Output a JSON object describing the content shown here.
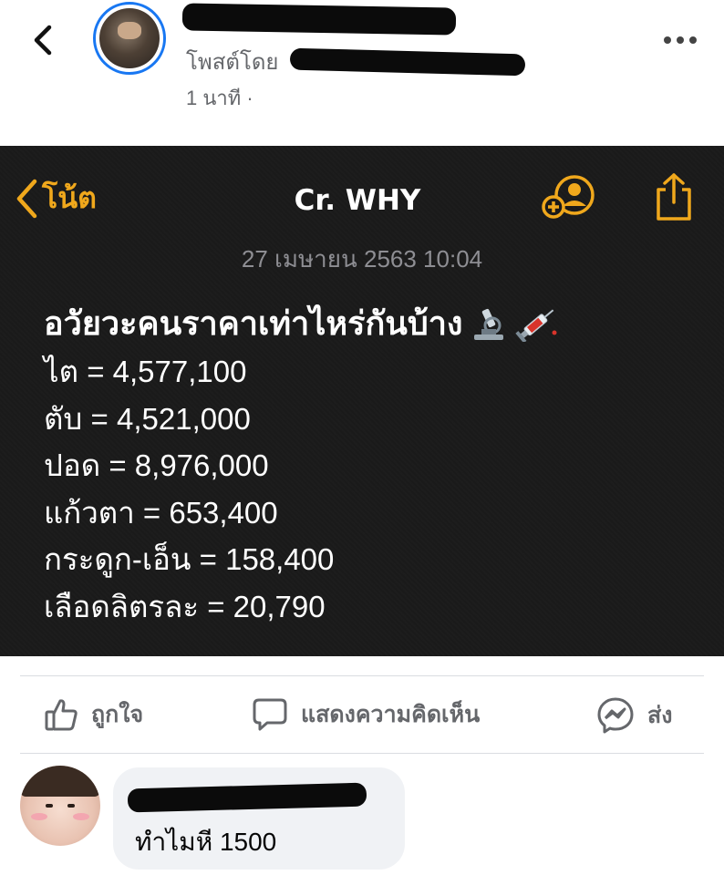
{
  "post": {
    "posted_by_label": "โพสต์โดย",
    "time": "1 นาที ·"
  },
  "note": {
    "back_label": "โน้ต",
    "title": "Cr. WHY",
    "date": "27 เมษายน 2563 10:04",
    "heading": "อวัยวะคนราคาเท่าไหร่กันบ้าง",
    "lines": [
      "ไต = 4,577,100",
      "ตับ = 4,521,000",
      "ปอด = 8,976,000",
      "แก้วตา = 653,400",
      "กระดูก-เอ็น = 158,400",
      "เลือดลิตรละ = 20,790"
    ],
    "accent_color": "#f0a81c",
    "background_color": "#1a1a1a"
  },
  "actions": {
    "like": "ถูกใจ",
    "comment": "แสดงความคิดเห็น",
    "share": "ส่ง"
  },
  "comment": {
    "text": "ทำไมหี 1500"
  },
  "colors": {
    "facebook_blue": "#1877f2",
    "muted_text": "#65676b"
  }
}
